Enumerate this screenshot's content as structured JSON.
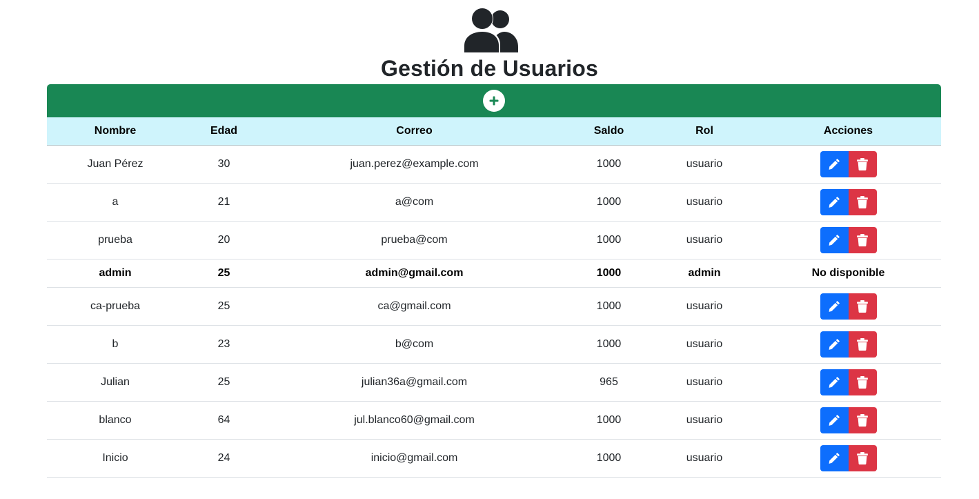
{
  "header": {
    "icon": "users-icon",
    "title": "Gestión de Usuarios"
  },
  "add_button": {
    "icon": "plus-circle-icon",
    "color": "#198754"
  },
  "table": {
    "columns": [
      "Nombre",
      "Edad",
      "Correo",
      "Saldo",
      "Rol",
      "Acciones"
    ],
    "header_color": "#cff4fc",
    "rows": [
      {
        "nombre": "Juan Pérez",
        "edad": "30",
        "correo": "juan.perez@example.com",
        "saldo": "1000",
        "rol": "usuario",
        "acciones": ""
      },
      {
        "nombre": "a",
        "edad": "21",
        "correo": "a@com",
        "saldo": "1000",
        "rol": "usuario",
        "acciones": ""
      },
      {
        "nombre": "prueba",
        "edad": "20",
        "correo": "prueba@com",
        "saldo": "1000",
        "rol": "usuario",
        "acciones": ""
      },
      {
        "nombre": "admin",
        "edad": "25",
        "correo": "admin@gmail.com",
        "saldo": "1000",
        "rol": "admin",
        "acciones": "No disponible"
      },
      {
        "nombre": "ca-prueba",
        "edad": "25",
        "correo": "ca@gmail.com",
        "saldo": "1000",
        "rol": "usuario",
        "acciones": ""
      },
      {
        "nombre": "b",
        "edad": "23",
        "correo": "b@com",
        "saldo": "1000",
        "rol": "usuario",
        "acciones": ""
      },
      {
        "nombre": "Julian",
        "edad": "25",
        "correo": "julian36a@gmail.com",
        "saldo": "965",
        "rol": "usuario",
        "acciones": ""
      },
      {
        "nombre": "blanco",
        "edad": "64",
        "correo": "jul.blanco60@gmail.com",
        "saldo": "1000",
        "rol": "usuario",
        "acciones": ""
      },
      {
        "nombre": "Inicio",
        "edad": "24",
        "correo": "inicio@gmail.com",
        "saldo": "1000",
        "rol": "usuario",
        "acciones": ""
      }
    ]
  },
  "action_buttons": {
    "edit_icon": "pencil-icon",
    "edit_color": "#0d6efd",
    "delete_icon": "trash-icon",
    "delete_color": "#dc3545"
  }
}
